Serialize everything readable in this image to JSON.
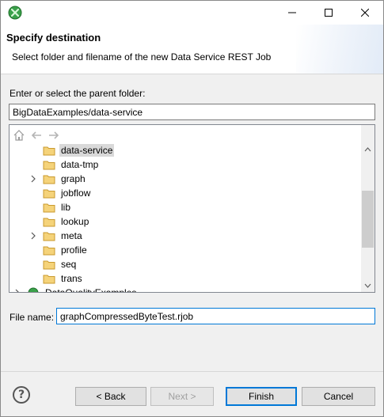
{
  "window": {
    "controls": [
      "minimize",
      "maximize",
      "close"
    ]
  },
  "header": {
    "title": "Specify destination",
    "description": "Select folder and filename of the new Data Service REST Job"
  },
  "parent_folder": {
    "label": "Enter or select the parent folder:",
    "value": "BigDataExamples/data-service"
  },
  "tree": {
    "toolbar": [
      "home-icon",
      "back-arrow-icon",
      "forward-arrow-icon"
    ],
    "items": [
      {
        "label": "data-service",
        "expandable": false,
        "selected": true
      },
      {
        "label": "data-tmp",
        "expandable": false,
        "selected": false
      },
      {
        "label": "graph",
        "expandable": true,
        "selected": false
      },
      {
        "label": "jobflow",
        "expandable": false,
        "selected": false
      },
      {
        "label": "lib",
        "expandable": false,
        "selected": false
      },
      {
        "label": "lookup",
        "expandable": false,
        "selected": false
      },
      {
        "label": "meta",
        "expandable": true,
        "selected": false
      },
      {
        "label": "profile",
        "expandable": false,
        "selected": false
      },
      {
        "label": "seq",
        "expandable": false,
        "selected": false
      },
      {
        "label": "trans",
        "expandable": false,
        "selected": false
      }
    ],
    "project": {
      "label": "DataQualityExamples",
      "expandable": true
    }
  },
  "file_name": {
    "label": "File name:",
    "value": "graphCompressedByteTest.rjob"
  },
  "buttons": {
    "help": "?",
    "back": "< Back",
    "next": "Next >",
    "finish": "Finish",
    "cancel": "Cancel"
  },
  "colors": {
    "selection": "#d9d9d9",
    "default_button_border": "#0078d7",
    "folder": "#e8b84a"
  }
}
